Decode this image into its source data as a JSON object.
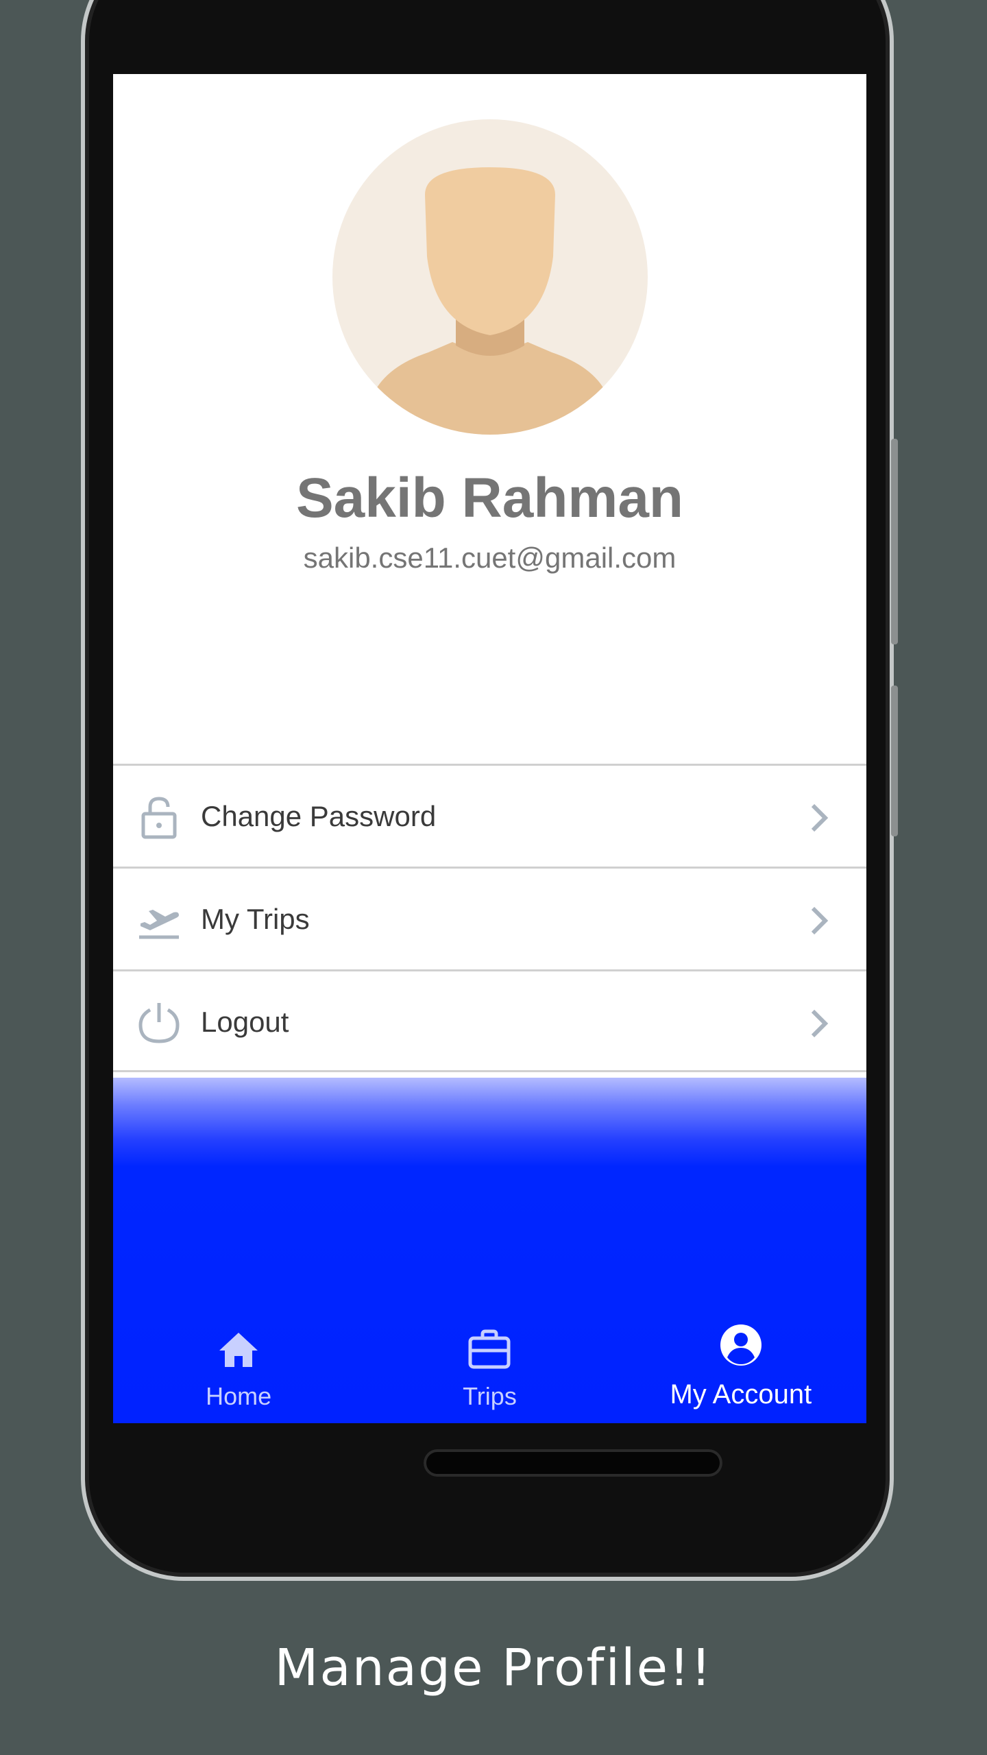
{
  "profile": {
    "name": "Sakib Rahman",
    "email": "sakib.cse11.cuet@gmail.com",
    "avatar_icon": "default-person-avatar"
  },
  "menu": [
    {
      "label": "Change Password",
      "icon": "lock-icon"
    },
    {
      "label": "My Trips",
      "icon": "airplane-takeoff-icon"
    },
    {
      "label": "Logout",
      "icon": "power-icon"
    }
  ],
  "bottom_nav": [
    {
      "label": "Home",
      "icon": "home-icon",
      "active": false
    },
    {
      "label": "Trips",
      "icon": "briefcase-icon",
      "active": false
    },
    {
      "label": "My Account",
      "icon": "account-circle-icon",
      "active": true
    }
  ],
  "caption": "Manage Profile!!",
  "colors": {
    "background": "#4c5756",
    "nav_blue": "#0022ff",
    "text_gray": "#757575"
  }
}
